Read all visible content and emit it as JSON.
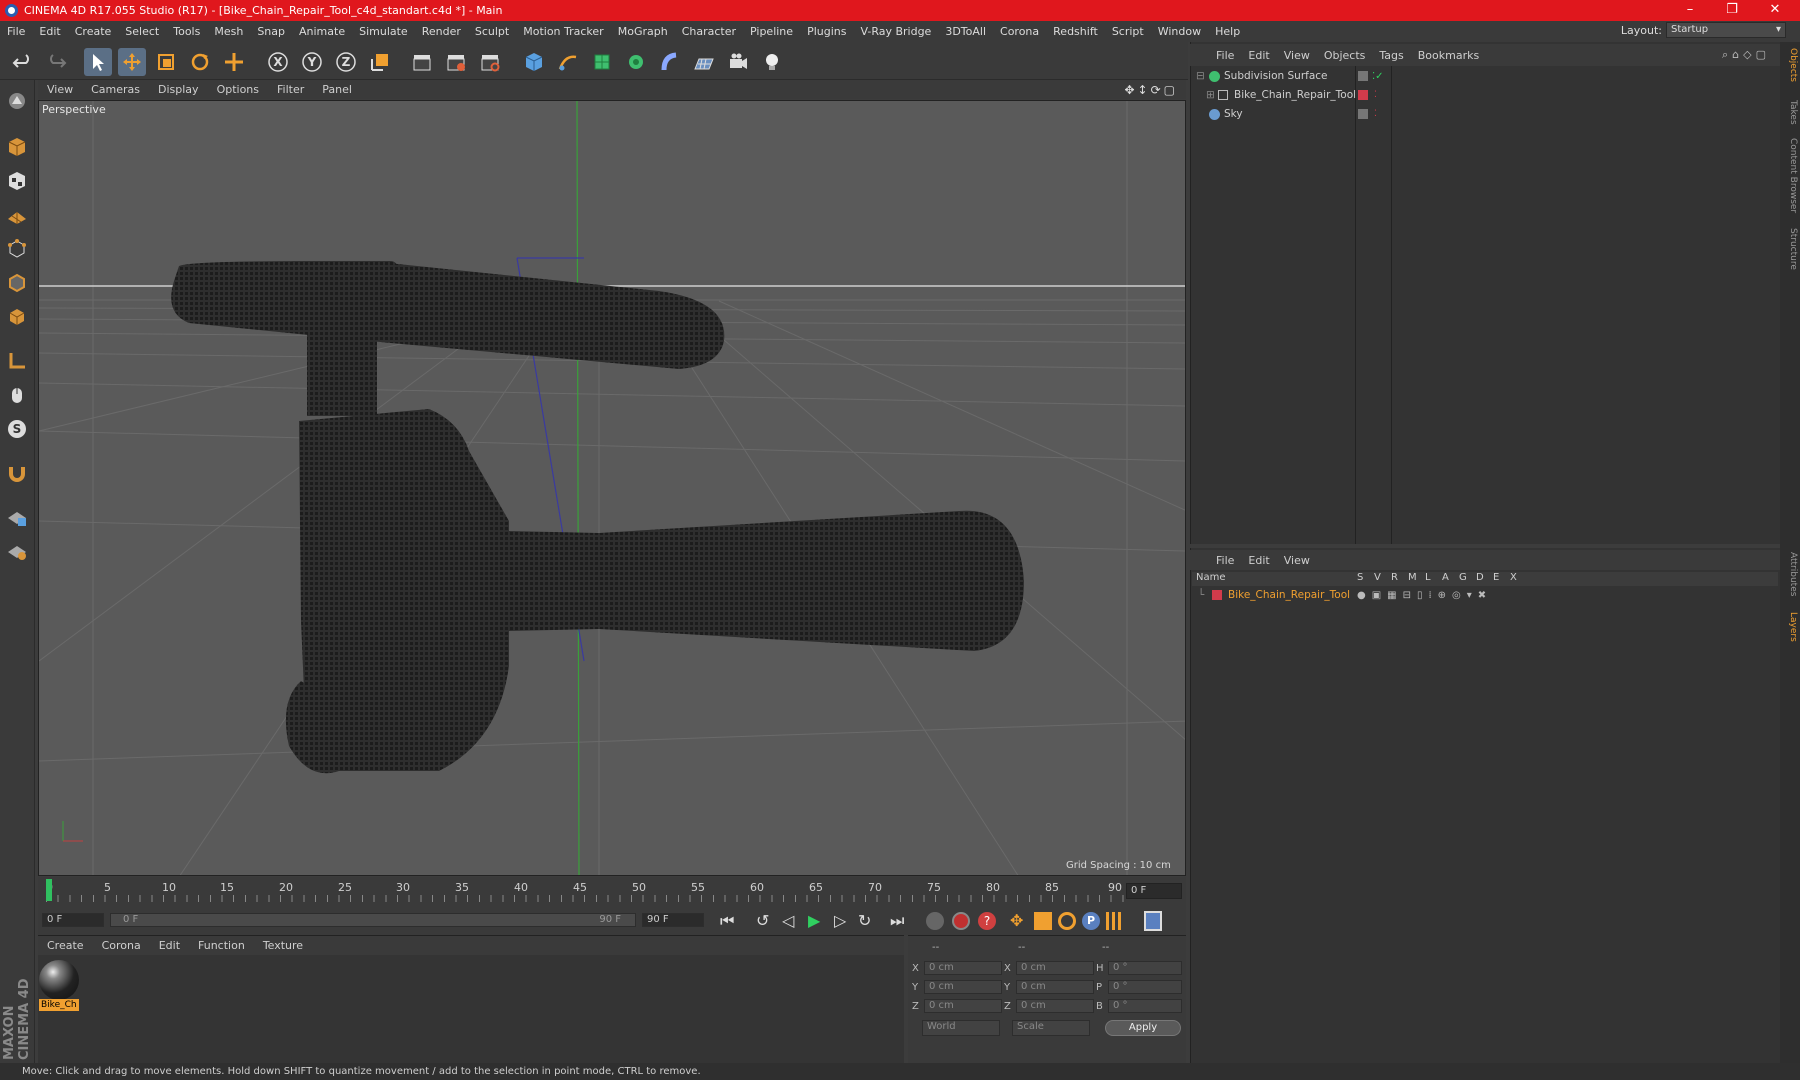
{
  "titlebar": {
    "title": "CINEMA 4D R17.055 Studio (R17) - [Bike_Chain_Repair_Tool_c4d_standart.c4d *] - Main"
  },
  "menu": [
    "File",
    "Edit",
    "Create",
    "Select",
    "Tools",
    "Mesh",
    "Snap",
    "Animate",
    "Simulate",
    "Render",
    "Sculpt",
    "Motion Tracker",
    "MoGraph",
    "Character",
    "Pipeline",
    "Plugins",
    "V-Ray Bridge",
    "3DToAll",
    "Corona",
    "Redshift",
    "Script",
    "Window",
    "Help"
  ],
  "layout": {
    "label": "Layout:",
    "value": "Startup"
  },
  "viewport": {
    "menu": [
      "View",
      "Cameras",
      "Display",
      "Options",
      "Filter",
      "Panel"
    ],
    "label": "Perspective",
    "grid_spacing": "Grid Spacing : 10 cm"
  },
  "timeline": {
    "ticks": [
      "0",
      "5",
      "10",
      "15",
      "20",
      "25",
      "30",
      "35",
      "40",
      "45",
      "50",
      "55",
      "60",
      "65",
      "70",
      "75",
      "80",
      "85",
      "90"
    ],
    "current_frame": "0 F",
    "start": "0 F",
    "slider_start": "0 F",
    "slider_end": "90 F",
    "end": "90 F"
  },
  "materials": {
    "menu": [
      "Create",
      "Corona",
      "Edit",
      "Function",
      "Texture"
    ],
    "items": [
      {
        "name": "Bike_Ch"
      }
    ]
  },
  "coords": {
    "headers": [
      "--",
      "--",
      "--"
    ],
    "rows": [
      {
        "a": "X",
        "av": "0 cm",
        "b": "X",
        "bv": "0 cm",
        "c": "H",
        "cv": "0 °"
      },
      {
        "a": "Y",
        "av": "0 cm",
        "b": "Y",
        "bv": "0 cm",
        "c": "P",
        "cv": "0 °"
      },
      {
        "a": "Z",
        "av": "0 cm",
        "b": "Z",
        "bv": "0 cm",
        "c": "B",
        "cv": "0 °"
      }
    ],
    "world": "World",
    "scale": "Scale",
    "apply": "Apply"
  },
  "objects": {
    "menu": [
      "File",
      "Edit",
      "View",
      "Objects",
      "Tags",
      "Bookmarks"
    ],
    "items": [
      {
        "name": "Subdivision Surface"
      },
      {
        "name": "Bike_Chain_Repair_Tool"
      },
      {
        "name": "Sky"
      }
    ]
  },
  "layers": {
    "menu": [
      "File",
      "Edit",
      "View"
    ],
    "columns": [
      "Name",
      "S",
      "V",
      "R",
      "M",
      "L",
      "A",
      "G",
      "D",
      "E",
      "X"
    ],
    "items": [
      {
        "name": "Bike_Chain_Repair_Tool"
      }
    ]
  },
  "side_tabs": [
    "Objects",
    "Takes",
    "Content Browser",
    "Structure",
    "Attributes",
    "Layers"
  ],
  "brand": "MAXON CINEMA 4D",
  "status": "Move: Click and drag to move elements. Hold down SHIFT to quantize movement / add to the selection in point mode, CTRL to remove.",
  "colors": {
    "titlebar": "#e0171d",
    "accent": "#f0a030",
    "layer_red": "#d23b4b"
  }
}
